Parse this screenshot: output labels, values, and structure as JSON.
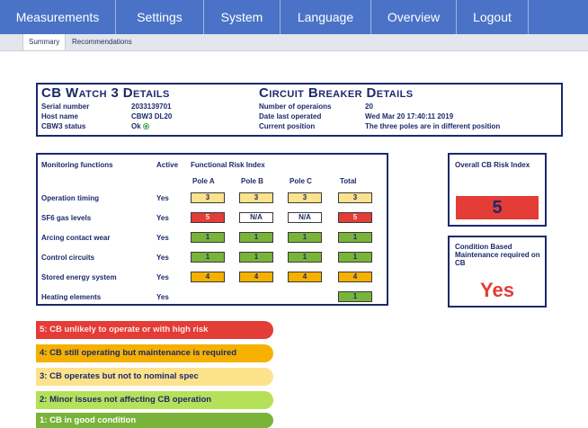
{
  "nav": {
    "items": [
      "Measurements",
      "Settings",
      "System",
      "Language",
      "Overview",
      "Logout"
    ]
  },
  "subnav": {
    "tabs": [
      "Summary",
      "Recommendations"
    ],
    "active": "Summary"
  },
  "details": {
    "cbwatch_title": "CB Watch 3 Details",
    "breaker_title": "Circuit Breaker Details",
    "serial_label": "Serial number",
    "serial_value": "2033139701",
    "host_label": "Host name",
    "host_value": "CBW3 DL20",
    "status_label": "CBW3 status",
    "status_value": "Ok",
    "ops_label": "Number of operaions",
    "ops_value": "20",
    "date_label": "Date last operated",
    "date_value": "Wed Mar 20 17:40:11 2019",
    "position_label": "Current position",
    "position_value": "The three poles are in different position"
  },
  "monitor": {
    "col_functions": "Monitoring functions",
    "col_active": "Active",
    "col_fri": "Functional Risk Index",
    "col_pole_a": "Pole A",
    "col_pole_b": "Pole B",
    "col_pole_c": "Pole C",
    "col_total": "Total",
    "rows": [
      {
        "name": "Operation timing",
        "active": "Yes",
        "a": "3",
        "b": "3",
        "c": "3",
        "total": "3"
      },
      {
        "name": "SF6 gas levels",
        "active": "Yes",
        "a": "5",
        "b": "N/A",
        "c": "N/A",
        "total": "5"
      },
      {
        "name": "Arcing contact wear",
        "active": "Yes",
        "a": "1",
        "b": "1",
        "c": "1",
        "total": "1"
      },
      {
        "name": "Control circuits",
        "active": "Yes",
        "a": "1",
        "b": "1",
        "c": "1",
        "total": "1"
      },
      {
        "name": "Stored energy system",
        "active": "Yes",
        "a": "4",
        "b": "4",
        "c": "4",
        "total": "4"
      },
      {
        "name": "Heating elements",
        "active": "Yes",
        "a": "",
        "b": "",
        "c": "",
        "total": "1"
      }
    ]
  },
  "risk": {
    "label": "Overall CB Risk Index",
    "value": "5"
  },
  "cbm": {
    "label": "Condition Based Maintenance required on CB",
    "value": "Yes"
  },
  "legend": [
    {
      "text": "5: CB unlikely to operate or with high risk",
      "color": "#e43c36",
      "text_color": "#fde7e6"
    },
    {
      "text": "4: CB still operating but maintenance is required",
      "color": "#f5b000",
      "text_color": "#1b2a6b"
    },
    {
      "text": "3: CB operates but not to nominal spec",
      "color": "#fde28c",
      "text_color": "#1b2a6b"
    },
    {
      "text": "2: Minor issues not affecting CB operation",
      "color": "#b5e05a",
      "text_color": "#1b2a6b"
    },
    {
      "text": "1: CB in good condition",
      "color": "#79b43a",
      "text_color": "#ffffff"
    }
  ],
  "colors": {
    "nav_bg": "#4a73c7",
    "frame": "#1b2a6b",
    "risk_5": "#e43c36",
    "risk_4": "#f5b000",
    "risk_3": "#fde28c",
    "risk_1": "#79b43a"
  },
  "icons": {
    "status_ok": "ok-circle-icon"
  }
}
